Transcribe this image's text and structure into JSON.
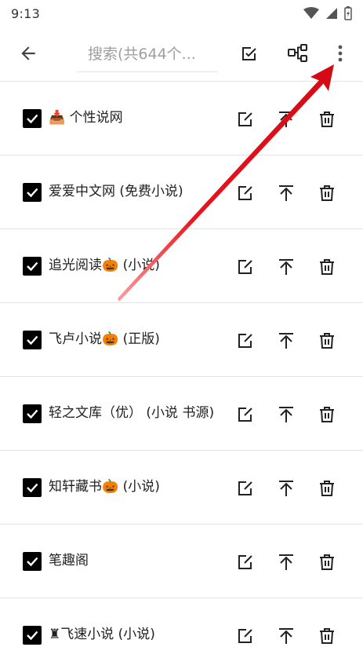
{
  "status": {
    "time": "9:13"
  },
  "toolbar": {
    "search_placeholder": "搜索(共644个..."
  },
  "sources": [
    {
      "label": "📥 个性说网",
      "checked": true
    },
    {
      "label": "爱爱中文网 (免费小说)",
      "checked": true
    },
    {
      "label": "追光阅读🎃 (小说)",
      "checked": true
    },
    {
      "label": "飞卢小说🎃 (正版)",
      "checked": true
    },
    {
      "label": "轻之文库（优） (小说 书源)",
      "checked": true
    },
    {
      "label": "知轩藏书🎃 (小说)",
      "checked": true
    },
    {
      "label": "笔趣阁",
      "checked": true
    },
    {
      "label": "♜飞速小说 (小说)",
      "checked": true
    }
  ],
  "colors": {
    "annotation_arrow": "#e8141e",
    "icon": "#222222",
    "checkbox": "#000000"
  }
}
